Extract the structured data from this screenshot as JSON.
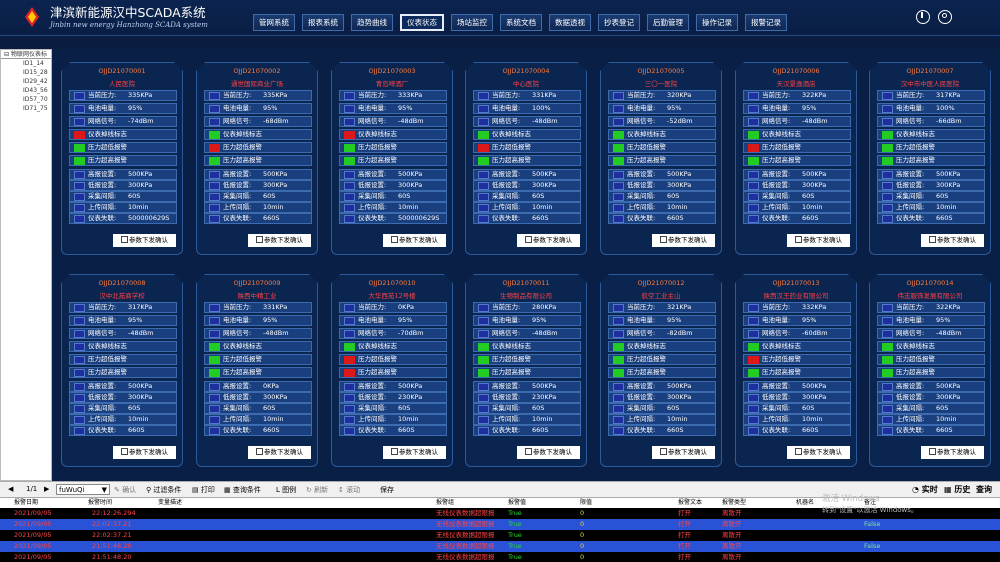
{
  "app": {
    "title": "津滨新能源汉中SCADA系统",
    "subtitle": "Jinbin new energy Hanzhong SCADA system"
  },
  "nav": [
    "管网系统",
    "报表系统",
    "趋势曲线",
    "仪表状态",
    "场站监控",
    "系统文档",
    "数据透视",
    "抄表登记",
    "后勤管理",
    "操作记录",
    "报警记录"
  ],
  "nav_active": "仪表状态",
  "tree": {
    "root": "物联网仪表标",
    "items": [
      "ID1_14",
      "ID15_28",
      "ID29_42",
      "ID43_56",
      "ID57_70",
      "ID71_75"
    ]
  },
  "labels": [
    "当前压力:",
    "电池电量:",
    "网络信号:",
    "仪表掉线标志",
    "压力超低报警",
    "压力超高报警",
    "高报设置:",
    "低报设置:",
    "采集间隔:",
    "上传间隔:",
    "仪表失联:"
  ],
  "confirm_label": "参数下发确认",
  "colors": {
    "orange": "#ff7a3a",
    "red": "#dd1818",
    "green": "#22cc22"
  },
  "cards": [
    {
      "id": "OJJD21070001",
      "loc": "人民医院",
      "p": "335KPa",
      "bat": "95%",
      "sig": "-74dBm",
      "f": [
        "r",
        "g",
        "g"
      ],
      "hi": "500KPa",
      "lo": "300KPa",
      "col": "60S",
      "up": "10min",
      "lost": "500000629S"
    },
    {
      "id": "OJJD21070002",
      "loc": "通世国际商业广场",
      "p": "335KPa",
      "bat": "95%",
      "sig": "-68dBm",
      "f": [
        "g",
        "r",
        "g"
      ],
      "hi": "500KPa",
      "lo": "300KPa",
      "col": "60S",
      "up": "10min",
      "lost": "660S"
    },
    {
      "id": "OJJD21070003",
      "loc": "青岛啤酒厂",
      "p": "333KPa",
      "bat": "95%",
      "sig": "-48dBm",
      "f": [
        "r",
        "g",
        "g"
      ],
      "hi": "500KPa",
      "lo": "300KPa",
      "col": "60S",
      "up": "10min",
      "lost": "500000629S"
    },
    {
      "id": "OJJD21070004",
      "loc": "中心医院",
      "p": "331KPa",
      "bat": "100%",
      "sig": "-48dBm",
      "f": [
        "g",
        "r",
        "g"
      ],
      "hi": "500KPa",
      "lo": "300KPa",
      "col": "60S",
      "up": "10min",
      "lost": "660S"
    },
    {
      "id": "OJJD21070005",
      "loc": "三〇一医院",
      "p": "320KPa",
      "bat": "95%",
      "sig": "-52dBm",
      "f": [
        "g",
        "g",
        "g"
      ],
      "hi": "500KPa",
      "lo": "300KPa",
      "col": "60S",
      "up": "10min",
      "lost": "660S"
    },
    {
      "id": "OJJD21070006",
      "loc": "天汉景逸酒店",
      "p": "322KPa",
      "bat": "95%",
      "sig": "-48dBm",
      "f": [
        "g",
        "r",
        "g"
      ],
      "hi": "500KPa",
      "lo": "300KPa",
      "col": "60S",
      "up": "10min",
      "lost": "660S"
    },
    {
      "id": "OJJD21070007",
      "loc": "汉中市中医人民医院",
      "p": "317KPa",
      "bat": "100%",
      "sig": "-66dBm",
      "f": [
        "g",
        "g",
        "g"
      ],
      "hi": "500KPa",
      "lo": "300KPa",
      "col": "60S",
      "up": "10min",
      "lost": "660S"
    },
    {
      "id": "OJJD21070008",
      "loc": "汉中北苑商学校",
      "p": "317KPa",
      "bat": "95%",
      "sig": "-48dBm",
      "f": [
        "b",
        "b",
        "b"
      ],
      "hi": "500KPa",
      "lo": "300KPa",
      "col": "60S",
      "up": "10min",
      "lost": "660S"
    },
    {
      "id": "OJJD21070009",
      "loc": "陕西中精工业",
      "p": "331KPa",
      "bat": "95%",
      "sig": "-48dBm",
      "f": [
        "g",
        "g",
        "g"
      ],
      "hi": "0KPa",
      "lo": "300KPa",
      "col": "60S",
      "up": "10min",
      "lost": "660S"
    },
    {
      "id": "OJJD21070010",
      "loc": "大华西苑12号楼",
      "p": "0KPa",
      "bat": "95%",
      "sig": "-70dBm",
      "f": [
        "g",
        "r",
        "r"
      ],
      "hi": "500KPa",
      "lo": "230KPa",
      "col": "60S",
      "up": "10min",
      "lost": "660S"
    },
    {
      "id": "OJJD21070011",
      "loc": "生物制品有限公司",
      "p": "280KPa",
      "bat": "95%",
      "sig": "-48dBm",
      "f": [
        "g",
        "g",
        "g"
      ],
      "hi": "500KPa",
      "lo": "230KPa",
      "col": "60S",
      "up": "10min",
      "lost": "660S"
    },
    {
      "id": "OJJD21070012",
      "loc": "航空工业主山",
      "p": "321KPa",
      "bat": "95%",
      "sig": "-82dBm",
      "f": [
        "g",
        "g",
        "g"
      ],
      "hi": "500KPa",
      "lo": "300KPa",
      "col": "60S",
      "up": "10min",
      "lost": "660S"
    },
    {
      "id": "OJJD21070013",
      "loc": "陕西汉王药业有限公司",
      "p": "332KPa",
      "bat": "95%",
      "sig": "-60dBm",
      "f": [
        "g",
        "r",
        "g"
      ],
      "hi": "500KPa",
      "lo": "300KPa",
      "col": "60S",
      "up": "10min",
      "lost": "660S"
    },
    {
      "id": "OJJD21070014",
      "loc": "伟志服饰发展有限公司",
      "p": "322KPa",
      "bat": "95%",
      "sig": "-48dBm",
      "f": [
        "g",
        "g",
        "g"
      ],
      "hi": "500KPa",
      "lo": "300KPa",
      "col": "60S",
      "up": "10min",
      "lost": "660S"
    }
  ],
  "toolbar": {
    "page": "1/1",
    "user": "fuWuQi",
    "confirm": "确认",
    "filter": "过滤条件",
    "print": "打印",
    "query": "查询条件",
    "legend": "图例",
    "refresh": "刷新",
    "scroll": "滚动",
    "save": "保存",
    "realtime": "实时",
    "history": "历史",
    "search": "查询"
  },
  "table": {
    "headers": [
      "报警日期",
      "报警时间",
      "变量描述",
      "报警组",
      "报警值",
      "限值",
      "报警文本",
      "报警类型",
      "机器名",
      "备注"
    ],
    "rows": [
      {
        "d": "2021/09/05",
        "t": "22:12:26.294",
        "g": "无线仪表数据超限报",
        "v": "True",
        "l": "0",
        "x": "打开",
        "ty": "离散开",
        "n": "",
        "bg": "#000000"
      },
      {
        "d": "2021/09/05",
        "t": "22:02:37.21",
        "g": "无线仪表数据超限报",
        "v": "True",
        "l": "0",
        "x": "打开",
        "ty": "离散开",
        "n": "False",
        "bg": "#2a52d6"
      },
      {
        "d": "2021/09/05",
        "t": "22:02:37.21",
        "g": "无线仪表数据超限报",
        "v": "True",
        "l": "0",
        "x": "打开",
        "ty": "离散开",
        "n": "",
        "bg": "#000000"
      },
      {
        "d": "2021/09/05",
        "t": "21:51:48.20",
        "g": "无线仪表数据超限报",
        "v": "True",
        "l": "0",
        "x": "打开",
        "ty": "离散开",
        "n": "False",
        "bg": "#2a52d6"
      },
      {
        "d": "2021/09/05",
        "t": "21:51:48.20",
        "g": "无线仪表数据超限报",
        "v": "True",
        "l": "0",
        "x": "打开",
        "ty": "离散开",
        "n": "",
        "bg": "#000000"
      }
    ]
  },
  "watermark": {
    "line1": "激活 Windows",
    "line2": "转到\"设置\"以激活 Windows。"
  }
}
